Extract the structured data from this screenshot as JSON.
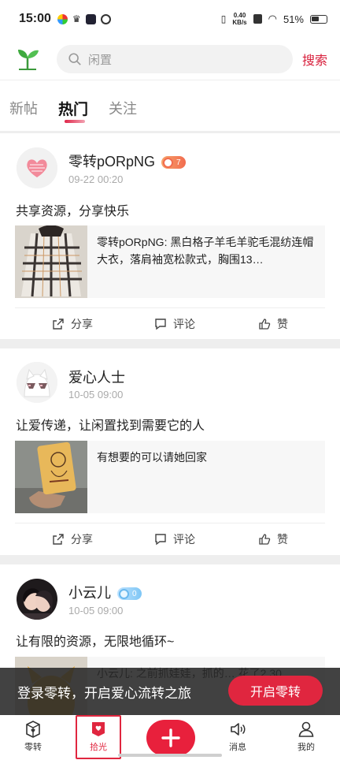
{
  "status_bar": {
    "time": "15:00",
    "net_speed_top": "0.40",
    "net_speed_bottom": "KB/s",
    "battery": "51%"
  },
  "header": {
    "search_placeholder": "闲置",
    "search_button": "搜索"
  },
  "tabs": [
    {
      "label": "新帖",
      "active": false
    },
    {
      "label": "热门",
      "active": true
    },
    {
      "label": "关注",
      "active": false
    }
  ],
  "posts": [
    {
      "username": "零转pORpNG",
      "level": "7",
      "time": "09-22 00:20",
      "text": "共享资源，分享快乐",
      "card_text": "零转pORpNG: 黑白格子羊毛羊驼毛混纺连帽大衣，落肩袖宽松款式，胸围13…",
      "actions": {
        "share": "分享",
        "comment": "评论",
        "like": "赞"
      }
    },
    {
      "username": "爱心人士",
      "time": "10-05 09:00",
      "text": "让爱传递，让闲置找到需要它的人",
      "card_text": "有想要的可以请她回家",
      "actions": {
        "share": "分享",
        "comment": "评论",
        "like": "赞"
      }
    },
    {
      "username": "小云儿",
      "level": "0",
      "time": "10-05 09:00",
      "text": "让有限的资源，无限地循环~",
      "card_text": "小云儿: 之前抓娃娃，抓的… 花了2.30"
    }
  ],
  "login_banner": {
    "text": "登录零转，开启爱心流转之旅",
    "button": "开启零转"
  },
  "bottom_nav": {
    "items": [
      {
        "label": "零转"
      },
      {
        "label": "拾光"
      },
      {
        "label": "消息"
      },
      {
        "label": "我的"
      }
    ]
  },
  "colors": {
    "accent": "#e0263f",
    "search_accent": "#d81e3b"
  }
}
